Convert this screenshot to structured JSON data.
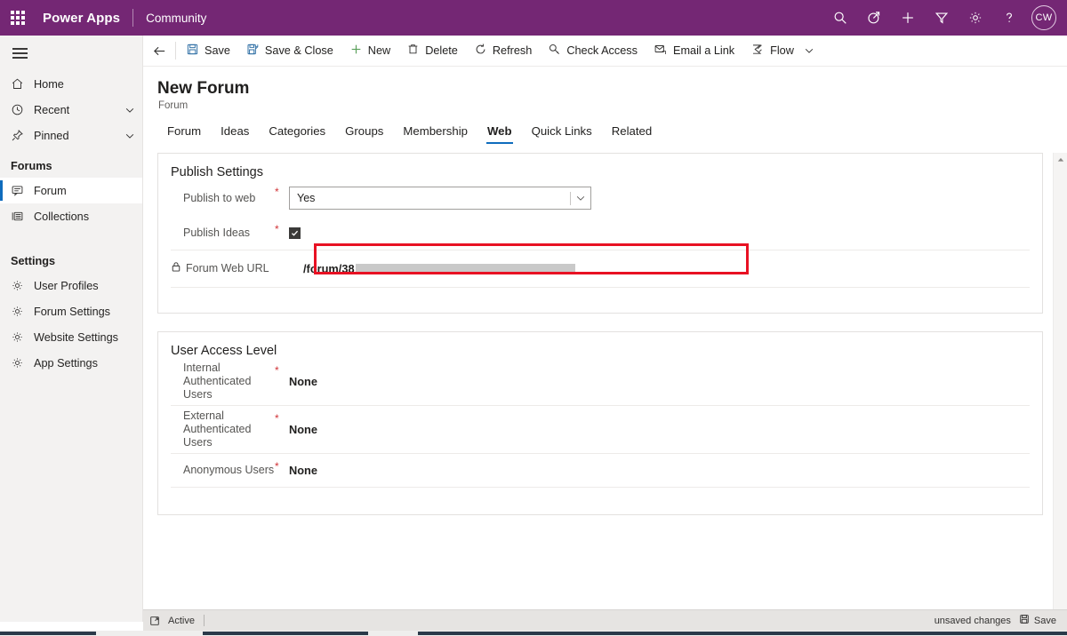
{
  "topbar": {
    "waffle_label": "waffle",
    "brand": "Power Apps",
    "app_name": "Community",
    "icons": [
      "search-icon",
      "assistant-icon",
      "add-icon",
      "filter-icon",
      "settings-icon",
      "help-icon"
    ],
    "avatar_initials": "CW",
    "background_color": "#742774"
  },
  "sidebar": {
    "items": [
      {
        "label": "Home",
        "icon": "home-icon",
        "chevron": false
      },
      {
        "label": "Recent",
        "icon": "clock-icon",
        "chevron": true
      },
      {
        "label": "Pinned",
        "icon": "pin-icon",
        "chevron": true
      }
    ],
    "group_forums": "Forums",
    "forum_items": [
      {
        "label": "Forum",
        "icon": "forum-icon",
        "selected": true
      },
      {
        "label": "Collections",
        "icon": "collections-icon",
        "selected": false
      }
    ],
    "group_settings": "Settings",
    "settings_items": [
      {
        "label": "User Profiles",
        "icon": "gear-icon"
      },
      {
        "label": "Forum Settings",
        "icon": "gear-icon"
      },
      {
        "label": "Website Settings",
        "icon": "gear-icon"
      },
      {
        "label": "App Settings",
        "icon": "gear-icon"
      }
    ],
    "selection_color": "#0f6cbd"
  },
  "commandbar": {
    "back_label": "back-arrow",
    "buttons": [
      {
        "label": "Save",
        "icon": "save-icon"
      },
      {
        "label": "Save & Close",
        "icon": "save-close-icon"
      },
      {
        "label": "New",
        "icon": "plus-icon"
      },
      {
        "label": "Delete",
        "icon": "trash-icon"
      },
      {
        "label": "Refresh",
        "icon": "refresh-icon"
      },
      {
        "label": "Check Access",
        "icon": "key-icon"
      },
      {
        "label": "Email a Link",
        "icon": "email-icon"
      },
      {
        "label": "Flow",
        "icon": "flow-icon"
      }
    ],
    "overflow_caret": "chevron-down-icon"
  },
  "form": {
    "title": "New Forum",
    "subtitle": "Forum",
    "tabs": [
      {
        "label": "Forum",
        "active": false
      },
      {
        "label": "Ideas",
        "active": false
      },
      {
        "label": "Categories",
        "active": false
      },
      {
        "label": "Groups",
        "active": false
      },
      {
        "label": "Membership",
        "active": false
      },
      {
        "label": "Web",
        "active": true
      },
      {
        "label": "Quick Links",
        "active": false
      },
      {
        "label": "Related",
        "active": false
      }
    ],
    "publish_settings": {
      "section_title": "Publish Settings",
      "publish_to_web": {
        "label": "Publish to web",
        "required": "*",
        "value": "Yes",
        "highlighted": true,
        "highlight_color": "#e81123"
      },
      "publish_ideas": {
        "label": "Publish Ideas",
        "required": "*",
        "checked": true
      },
      "forum_web_url": {
        "label": "Forum Web URL",
        "icon": "lock-icon",
        "value": "/forum/38",
        "redacted": true
      }
    },
    "user_access_level": {
      "section_title": "User Access Level",
      "rows": [
        {
          "label": "Internal Authenticated Users",
          "required": "*",
          "value": "None"
        },
        {
          "label": "External Authenticated Users",
          "required": "*",
          "value": "None"
        },
        {
          "label": "Anonymous Users",
          "required": "*",
          "value": "None"
        }
      ]
    }
  },
  "footer": {
    "expand_icon": "expand-icon",
    "status": "Active",
    "unsaved": "unsaved changes",
    "save_label": "Save",
    "save_icon": "save-icon"
  }
}
